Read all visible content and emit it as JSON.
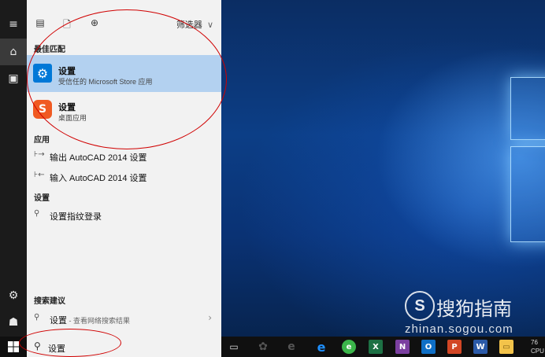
{
  "panel": {
    "filter_label": "筛选器",
    "best_match_header": "最佳匹配",
    "best_match": {
      "title": "设置",
      "subtitle": "受信任的 Microsoft Store 应用"
    },
    "second_result": {
      "title": "设置",
      "subtitle": "桌面应用"
    },
    "apps_header": "应用",
    "apps": [
      {
        "label": "输出 AutoCAD 2014 设置",
        "icon": "export-arrow-icon"
      },
      {
        "label": "输入 AutoCAD 2014 设置",
        "icon": "import-arrow-icon"
      }
    ],
    "settings_header": "设置",
    "settings_items": [
      {
        "label": "设置指纹登录",
        "icon": "search-icon"
      }
    ],
    "suggestions_header": "搜索建议",
    "suggestion": {
      "query": "设置",
      "hint": " - 查看网络搜索结果"
    }
  },
  "taskbar": {
    "search_value": "设置",
    "apps": [
      "task-view",
      "app-grid",
      "edge-legacy",
      "edge",
      "green-browser",
      "excel",
      "onenote",
      "outlook",
      "powerpoint",
      "word",
      "file-explorer"
    ],
    "tray_line1": "76",
    "tray_line2": "CPU"
  },
  "colors": {
    "accent": "#0078d7",
    "best_match_bg": "#b3d1f0",
    "annotation": "#d00000"
  },
  "watermark": {
    "brand": "搜狗指南",
    "url": "zhinan.sogou.com"
  }
}
